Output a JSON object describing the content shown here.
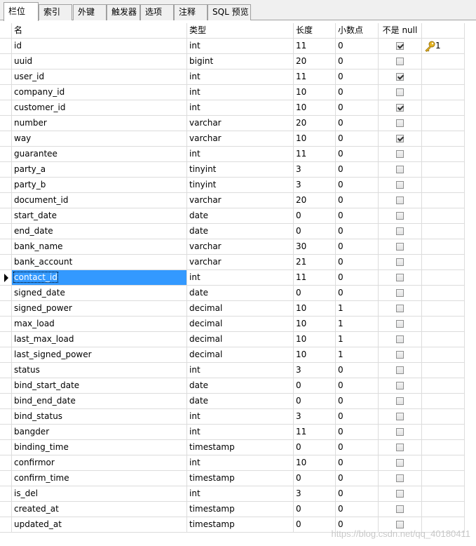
{
  "tabs": [
    "栏位",
    "索引",
    "外键",
    "触发器",
    "选项",
    "注释",
    "SQL 预览"
  ],
  "columns_header": {
    "name": "名",
    "type": "类型",
    "length": "长度",
    "decimals": "小数点",
    "not_null": "不是 null",
    "key": ""
  },
  "rows": [
    {
      "name": "id",
      "type": "int",
      "length": "11",
      "decimals": "0",
      "not_null": true,
      "key": "1"
    },
    {
      "name": "uuid",
      "type": "bigint",
      "length": "20",
      "decimals": "0",
      "not_null": false,
      "key": ""
    },
    {
      "name": "user_id",
      "type": "int",
      "length": "11",
      "decimals": "0",
      "not_null": true,
      "key": ""
    },
    {
      "name": "company_id",
      "type": "int",
      "length": "10",
      "decimals": "0",
      "not_null": false,
      "key": ""
    },
    {
      "name": "customer_id",
      "type": "int",
      "length": "10",
      "decimals": "0",
      "not_null": true,
      "key": ""
    },
    {
      "name": "number",
      "type": "varchar",
      "length": "20",
      "decimals": "0",
      "not_null": false,
      "key": ""
    },
    {
      "name": "way",
      "type": "varchar",
      "length": "10",
      "decimals": "0",
      "not_null": true,
      "key": ""
    },
    {
      "name": "guarantee",
      "type": "int",
      "length": "11",
      "decimals": "0",
      "not_null": false,
      "key": ""
    },
    {
      "name": "party_a",
      "type": "tinyint",
      "length": "3",
      "decimals": "0",
      "not_null": false,
      "key": ""
    },
    {
      "name": "party_b",
      "type": "tinyint",
      "length": "3",
      "decimals": "0",
      "not_null": false,
      "key": ""
    },
    {
      "name": "document_id",
      "type": "varchar",
      "length": "20",
      "decimals": "0",
      "not_null": false,
      "key": ""
    },
    {
      "name": "start_date",
      "type": "date",
      "length": "0",
      "decimals": "0",
      "not_null": false,
      "key": ""
    },
    {
      "name": "end_date",
      "type": "date",
      "length": "0",
      "decimals": "0",
      "not_null": false,
      "key": ""
    },
    {
      "name": "bank_name",
      "type": "varchar",
      "length": "30",
      "decimals": "0",
      "not_null": false,
      "key": ""
    },
    {
      "name": "bank_account",
      "type": "varchar",
      "length": "21",
      "decimals": "0",
      "not_null": false,
      "key": ""
    },
    {
      "name": "contact_id",
      "type": "int",
      "length": "11",
      "decimals": "0",
      "not_null": false,
      "key": "",
      "selected": true
    },
    {
      "name": "signed_date",
      "type": "date",
      "length": "0",
      "decimals": "0",
      "not_null": false,
      "key": ""
    },
    {
      "name": "signed_power",
      "type": "decimal",
      "length": "10",
      "decimals": "1",
      "not_null": false,
      "key": ""
    },
    {
      "name": "max_load",
      "type": "decimal",
      "length": "10",
      "decimals": "1",
      "not_null": false,
      "key": ""
    },
    {
      "name": "last_max_load",
      "type": "decimal",
      "length": "10",
      "decimals": "1",
      "not_null": false,
      "key": ""
    },
    {
      "name": "last_signed_power",
      "type": "decimal",
      "length": "10",
      "decimals": "1",
      "not_null": false,
      "key": ""
    },
    {
      "name": "status",
      "type": "int",
      "length": "3",
      "decimals": "0",
      "not_null": false,
      "key": ""
    },
    {
      "name": "bind_start_date",
      "type": "date",
      "length": "0",
      "decimals": "0",
      "not_null": false,
      "key": ""
    },
    {
      "name": "bind_end_date",
      "type": "date",
      "length": "0",
      "decimals": "0",
      "not_null": false,
      "key": ""
    },
    {
      "name": "bind_status",
      "type": "int",
      "length": "3",
      "decimals": "0",
      "not_null": false,
      "key": ""
    },
    {
      "name": "bangder",
      "type": "int",
      "length": "11",
      "decimals": "0",
      "not_null": false,
      "key": ""
    },
    {
      "name": "binding_time",
      "type": "timestamp",
      "length": "0",
      "decimals": "0",
      "not_null": false,
      "key": ""
    },
    {
      "name": "confirmor",
      "type": "int",
      "length": "10",
      "decimals": "0",
      "not_null": false,
      "key": ""
    },
    {
      "name": "confirm_time",
      "type": "timestamp",
      "length": "0",
      "decimals": "0",
      "not_null": false,
      "key": ""
    },
    {
      "name": "is_del",
      "type": "int",
      "length": "3",
      "decimals": "0",
      "not_null": false,
      "key": ""
    },
    {
      "name": "created_at",
      "type": "timestamp",
      "length": "0",
      "decimals": "0",
      "not_null": false,
      "key": ""
    },
    {
      "name": "updated_at",
      "type": "timestamp",
      "length": "0",
      "decimals": "0",
      "not_null": false,
      "key": ""
    }
  ],
  "watermark": "https://blog.csdn.net/qq_40180411",
  "icons": {
    "key": "key-icon",
    "current_row": "row-pointer-icon",
    "checkbox": "checkbox-icon"
  },
  "colors": {
    "selection": "#3399ff",
    "key_icon": "#e6b422",
    "grid_line": "#dcdcdc"
  }
}
